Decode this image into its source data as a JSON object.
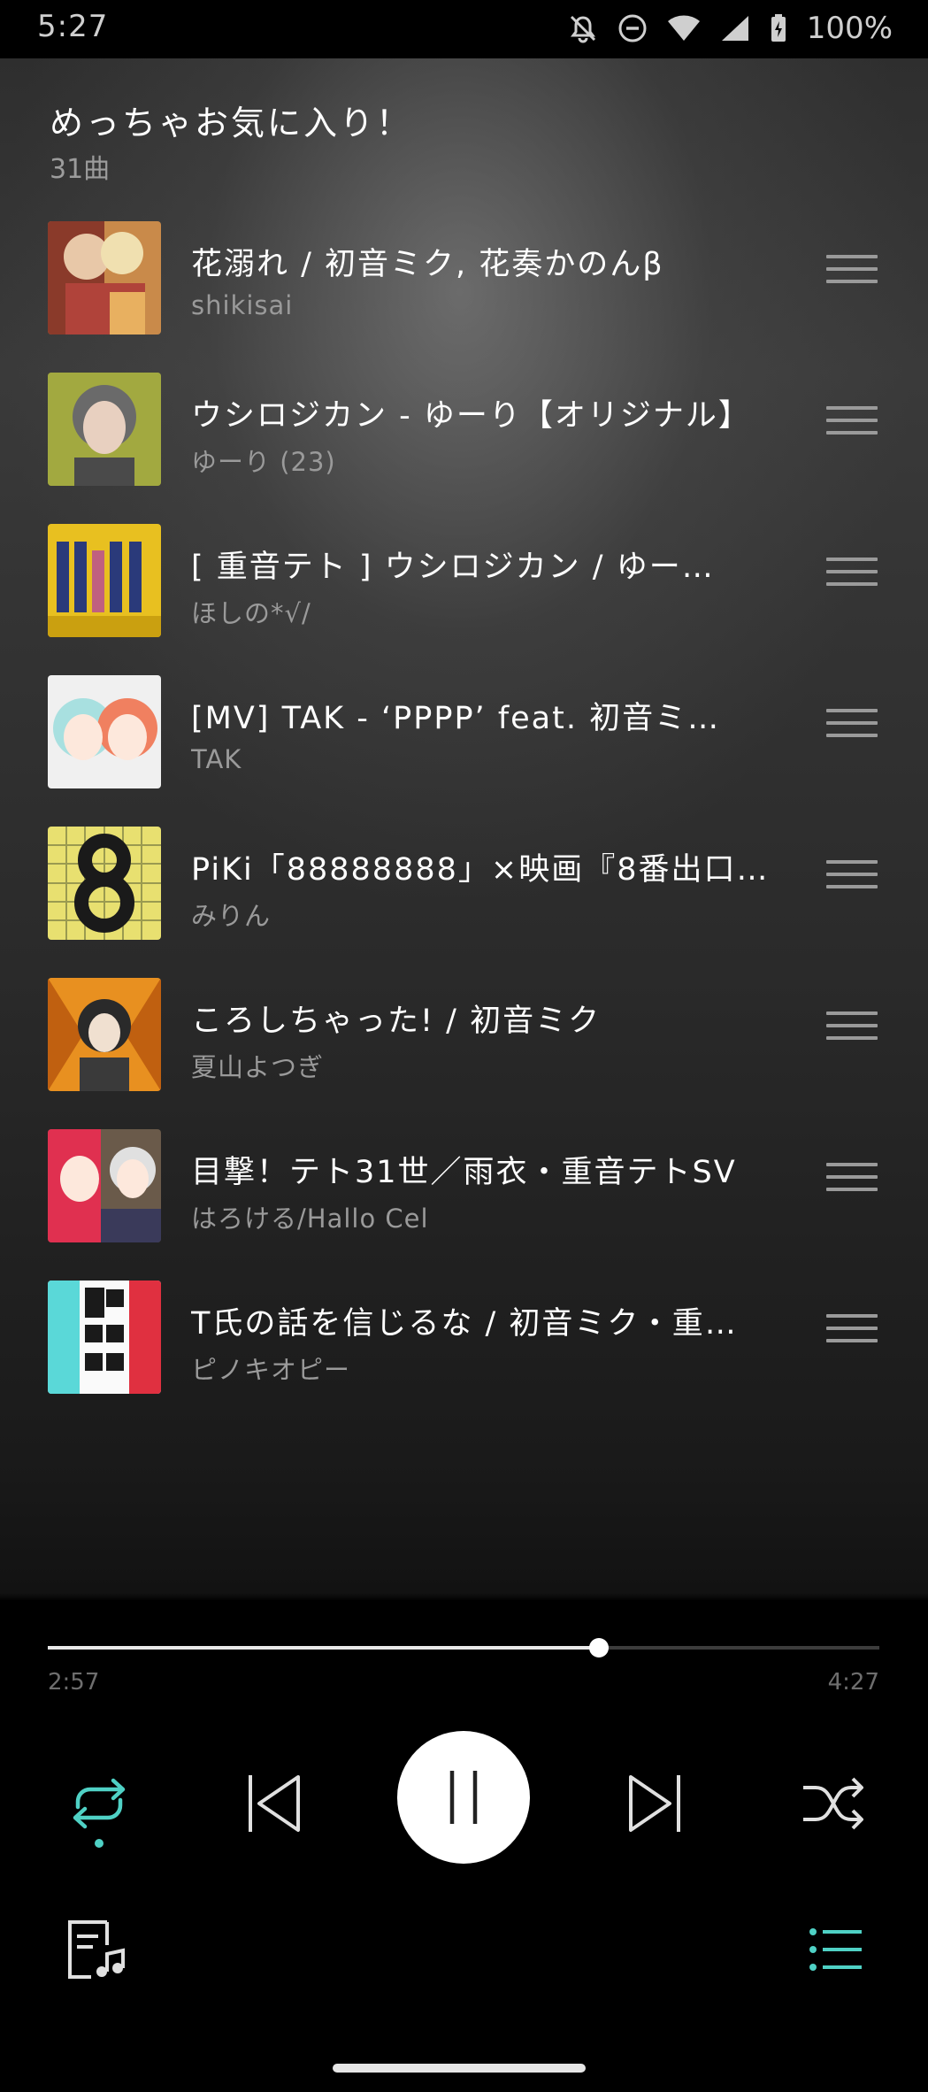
{
  "status_bar": {
    "time": "5:27",
    "battery": "100%",
    "icons": [
      "notifications-off-icon",
      "do-not-disturb-icon",
      "wifi-icon",
      "cellular-signal-icon",
      "battery-charging-icon"
    ]
  },
  "playlist": {
    "title": "めっちゃお気に入り！",
    "count": "31曲"
  },
  "tracks": [
    {
      "title": "花溺れ / 初音ミク, 花奏かのんβ",
      "artist": "shikisai"
    },
    {
      "title": "ウシロジカン - ゆーり【オリジナル】",
      "artist": "ゆーり (23)"
    },
    {
      "title": "[ 重音テト ] ウシロジカン / ゆー…",
      "artist": "ほしの*√/"
    },
    {
      "title": "[MV] TAK - ‘PPPP’ feat. 初音ミ…",
      "artist": "TAK"
    },
    {
      "title": "PiKi「88888888」×映画『8番出口』…",
      "artist": "みりん"
    },
    {
      "title": "ころしちゃった! / 初音ミク",
      "artist": "夏山よつぎ"
    },
    {
      "title": "目撃！テト31世／雨衣・重音テトSV",
      "artist": "はろける/Hallo Cel"
    },
    {
      "title": "T氏の話を信じるな / 初音ミク・重…",
      "artist": "ピノキオピー"
    }
  ],
  "player": {
    "elapsed": "2:57",
    "total": "4:27",
    "progress": 0.663,
    "accent_color": "#4fd1c5",
    "repeat_active": true
  }
}
